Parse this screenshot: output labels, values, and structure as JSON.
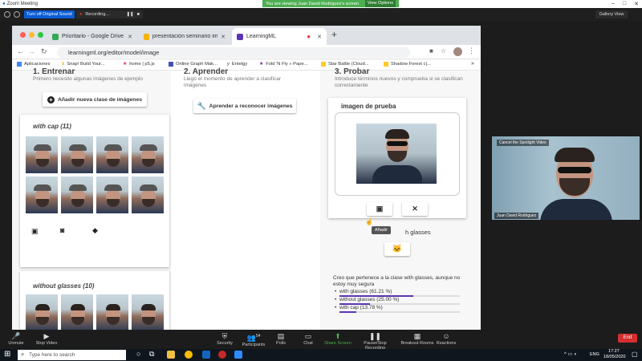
{
  "zoom": {
    "title": "Zoom Meeting",
    "share_banner": "You are viewing Juan David Rodriguez's screen",
    "view_options": "View Options",
    "turn_off_sound": "Turn off Original Sound",
    "recording": "Recording...",
    "gallery_view": "Gallery View",
    "spotlight_cancel": "Cancel the Spotlight Video",
    "spotlight_name": "Juan David Rodriguez",
    "controls": {
      "unmute": "Unmute",
      "stop_video": "Stop Video",
      "security": "Security",
      "participants": "Participants",
      "participants_count": "54",
      "polls": "Polls",
      "chat": "Chat",
      "share_screen": "Share Screen",
      "pause_recording": "Pause/Stop Recording",
      "breakout": "Breakout Rooms",
      "reactions": "Reactions",
      "end": "End"
    }
  },
  "browser": {
    "tabs": [
      {
        "label": "Prioritario - Google Drive"
      },
      {
        "label": "presentación seminario iml tas"
      },
      {
        "label": "LearningML"
      }
    ],
    "url": "learningml.org/editor/model/image",
    "bookmarks": [
      "Aplicaciones",
      "Snap! Build Your...",
      "home | p5.js",
      "Online Graph Mak...",
      "Entelgy",
      "Fold 'N Fly » Pape...",
      "Star Battle (Cloud...",
      "Shadow Forest c|..."
    ]
  },
  "page": {
    "train": {
      "title": "1. Entrenar",
      "desc": "Primero necesito algunas imágenes de ejemplo",
      "add_class_button": "Añadir nueva clase de imágenes",
      "class1": "with cap (11)",
      "class2": "without glasses (10)"
    },
    "learn": {
      "title": "2. Aprender",
      "desc": "Llegó el momento de aprender a clasificar imágenes",
      "learn_button": "Aprender a reconocer imágenes"
    },
    "test": {
      "title": "3. Probar",
      "desc": "Introduce términos nuevos y comprueba si se clasifican correctamente",
      "test_image_label": "imagen de prueba",
      "tooltip": "Añadir",
      "result_class_partial": "h glasses",
      "verdict": "Creo que pertenece a la clase with glasses, aunque no estoy muy segura",
      "results": [
        {
          "label": "with glasses (61.21 %)",
          "value": 61.21
        },
        {
          "label": "without glasses (25.00 %)",
          "value": 25.0
        },
        {
          "label": "with cap (13.78 %)",
          "value": 13.78
        }
      ]
    }
  },
  "taskbar": {
    "search_placeholder": "Type here to search",
    "time": "17:27",
    "date": "18/05/2020",
    "lang": "ENG"
  },
  "colors": {
    "accent": "#5e35b1",
    "zoom_blue": "#0b5cd5",
    "share_green": "#4caf50",
    "end_red": "#d32f2f"
  }
}
